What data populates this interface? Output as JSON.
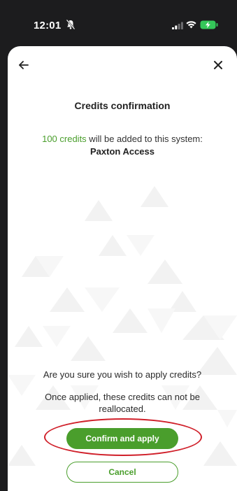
{
  "status_bar": {
    "time": "12:01"
  },
  "header": {
    "back_icon": "arrow-left-icon",
    "close_icon": "close-icon"
  },
  "content": {
    "title": "Credits confirmation",
    "credits_amount": "100 credits",
    "message_rest": " will be added to this system:",
    "system_name": "Paxton Access"
  },
  "footer": {
    "question": "Are you sure you wish to apply credits?",
    "warning": "Once applied, these credits can not be reallocated.",
    "confirm_label": "Confirm and apply",
    "cancel_label": "Cancel"
  },
  "colors": {
    "accent": "#4a9e2c",
    "highlight": "#d0202a"
  }
}
